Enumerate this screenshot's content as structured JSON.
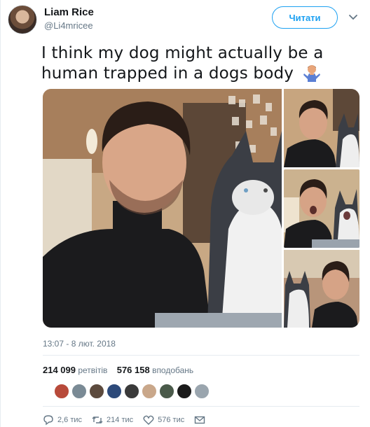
{
  "author": {
    "name": "Liam Rice",
    "handle": "@Li4mricee",
    "follow_label": "Читати"
  },
  "tweet": {
    "text": "I think my dog might actually be a human trapped in a dogs body",
    "emoji_icon": "man-shrugging-emoji",
    "timestamp": "13:07 - 8 лют. 2018"
  },
  "stats": {
    "retweets_count": "214 099",
    "retweets_label": "ретвітів",
    "likes_count": "576 158",
    "likes_label": "вподобань"
  },
  "likers": [
    {
      "color": "#b84a3a"
    },
    {
      "color": "#7a8a95"
    },
    {
      "color": "#5c4a3d"
    },
    {
      "color": "#2d4a7a"
    },
    {
      "color": "#3a3a3a"
    },
    {
      "color": "#c9a78a"
    },
    {
      "color": "#4a5a4a"
    },
    {
      "color": "#1a1a1a"
    },
    {
      "color": "#9aa5ae"
    }
  ],
  "actions": {
    "reply_count": "2,6 тис",
    "retweet_count": "214 тис",
    "like_count": "576 тис"
  },
  "colors": {
    "accent": "#1da1f2",
    "secondary_text": "#657786",
    "border": "#e6ecf0"
  }
}
